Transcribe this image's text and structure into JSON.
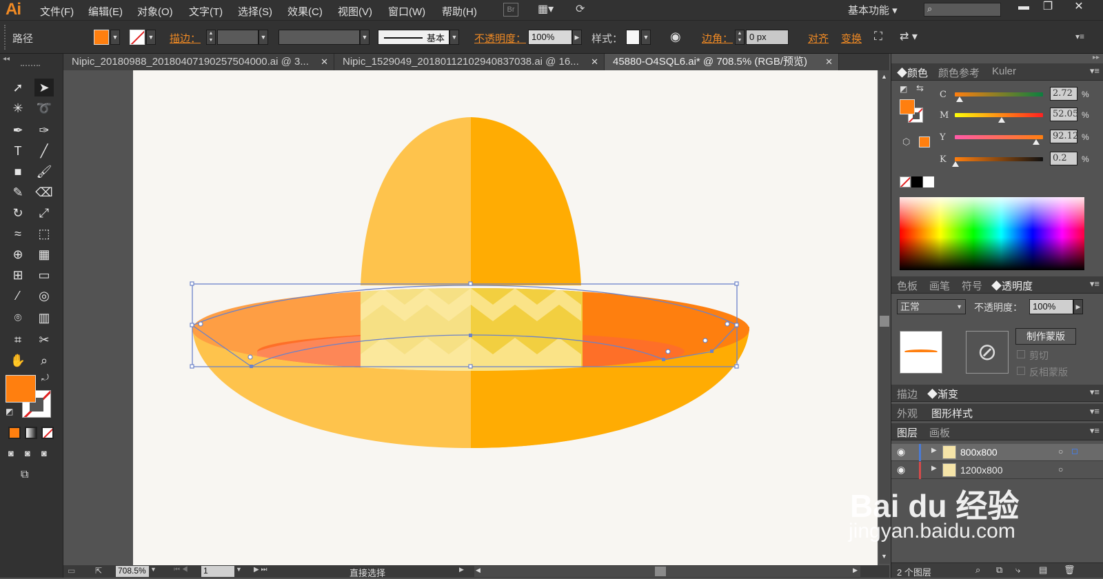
{
  "app": {
    "logo": "Ai",
    "workspace": "基本功能",
    "search_placeholder": ""
  },
  "menu": [
    "文件(F)",
    "编辑(E)",
    "对象(O)",
    "文字(T)",
    "选择(S)",
    "效果(C)",
    "视图(V)",
    "窗口(W)",
    "帮助(H)"
  ],
  "bridge_label": "Br",
  "control": {
    "object_type": "路径",
    "stroke_label": "描边：",
    "stroke_style": "基本",
    "opacity_label": "不透明度：",
    "opacity_value": "100%",
    "style_label": "样式：",
    "corner_label": "边角：",
    "corner_value": "0 px",
    "align_label": "对齐",
    "transform_label": "变换"
  },
  "tabs": [
    {
      "label": "Nipic_20180988_20180407190257504000.ai @ 3...",
      "active": false
    },
    {
      "label": "Nipic_1529049_20180112102940837038.ai @ 16...",
      "active": false
    },
    {
      "label": "45880-O4SQL6.ai* @ 708.5% (RGB/预览)",
      "active": true
    }
  ],
  "status": {
    "zoom": "708.5%",
    "page": "1",
    "tool_name": "直接选择"
  },
  "color_panel": {
    "tabs": [
      "颜色",
      "颜色参考",
      "Kuler"
    ],
    "fill_color": "#ff7f0f",
    "channels": [
      {
        "letter": "C",
        "value": "2.72",
        "fraction": 0.02
      },
      {
        "letter": "M",
        "value": "52.05",
        "fraction": 0.52
      },
      {
        "letter": "Y",
        "value": "92.12",
        "fraction": 0.92
      },
      {
        "letter": "K",
        "value": "0.2",
        "fraction": 0.0
      }
    ],
    "percent": "%"
  },
  "transparency_panel": {
    "tabs": [
      "色板",
      "画笔",
      "符号",
      "透明度"
    ],
    "blend_mode": "正常",
    "opacity_label": "不透明度：",
    "opacity_value": "100%",
    "make_mask": "制作蒙版",
    "clip": "剪切",
    "invert_mask": "反相蒙版"
  },
  "stroke_panel": {
    "tabs": [
      "描边",
      "渐变"
    ]
  },
  "appearance_panel": {
    "tabs": [
      "外观",
      "图形样式"
    ]
  },
  "layers_panel": {
    "tabs": [
      "图层",
      "画板"
    ],
    "layers": [
      {
        "name": "800x800",
        "selected": true
      },
      {
        "name": "1200x800",
        "selected": false
      }
    ],
    "count_label": "2 个图层"
  },
  "watermark": {
    "brand": "Bai du 经验",
    "url": "jingyan.baidu.com"
  },
  "colors": {
    "accent": "#f08a24",
    "hat_left": "#fec34c",
    "hat_right": "#ffac03",
    "brim_left": "#fe9e44",
    "brim_right": "#fe7f0f",
    "selection": "#6b82c9"
  }
}
